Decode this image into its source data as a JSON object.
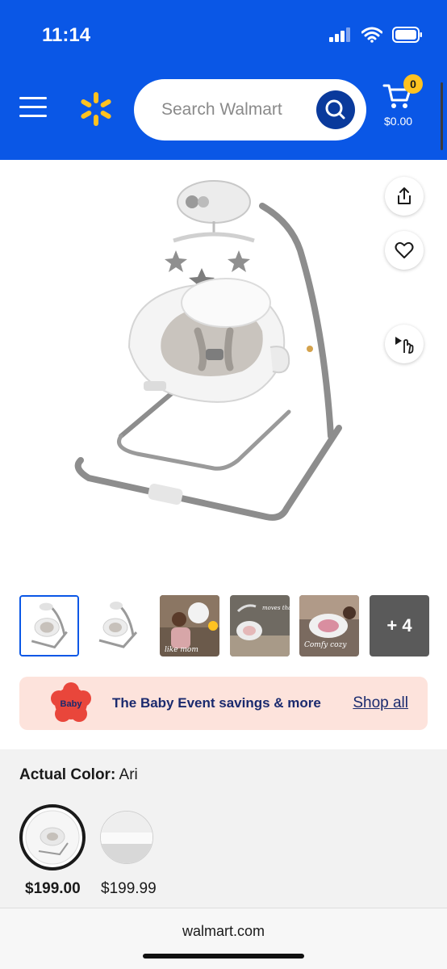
{
  "status_bar": {
    "time": "11:14",
    "icons": [
      "signal-icon",
      "wifi-icon",
      "battery-icon"
    ]
  },
  "header": {
    "menu_icon": "hamburger-icon",
    "logo_icon": "walmart-spark-icon",
    "search": {
      "placeholder": "Search Walmart",
      "icon": "search-icon"
    },
    "cart": {
      "count": "0",
      "total": "$0.00",
      "icon": "cart-icon"
    }
  },
  "product": {
    "image_icon": "baby-swing-image",
    "actions": [
      {
        "name": "share",
        "icon": "share-icon"
      },
      {
        "name": "favorite",
        "icon": "heart-icon"
      },
      {
        "name": "view-3d",
        "icon": "tap-3d-icon"
      }
    ],
    "thumbnails": [
      {
        "label": "",
        "selected": true
      },
      {
        "label": "",
        "selected": false
      },
      {
        "label": "like mom",
        "selected": false
      },
      {
        "label": "moves that soothe",
        "selected": false
      },
      {
        "label": "Comfy cozy",
        "selected": false
      },
      {
        "label": "+ 4",
        "selected": false
      }
    ]
  },
  "promo": {
    "badge_text": "The Baby Event",
    "text": "The Baby Event savings & more",
    "link": "Shop all"
  },
  "color": {
    "label": "Actual Color:",
    "value": "Ari",
    "options": [
      {
        "price": "$199.00",
        "selected": true
      },
      {
        "price": "$199.99",
        "selected": false
      }
    ]
  },
  "footer": {
    "domain": "walmart.com"
  },
  "colors": {
    "brand_blue": "#0a57e6",
    "yellow": "#ffc220",
    "navy": "#1a2a6e",
    "promo_bg": "#fde3dc"
  }
}
